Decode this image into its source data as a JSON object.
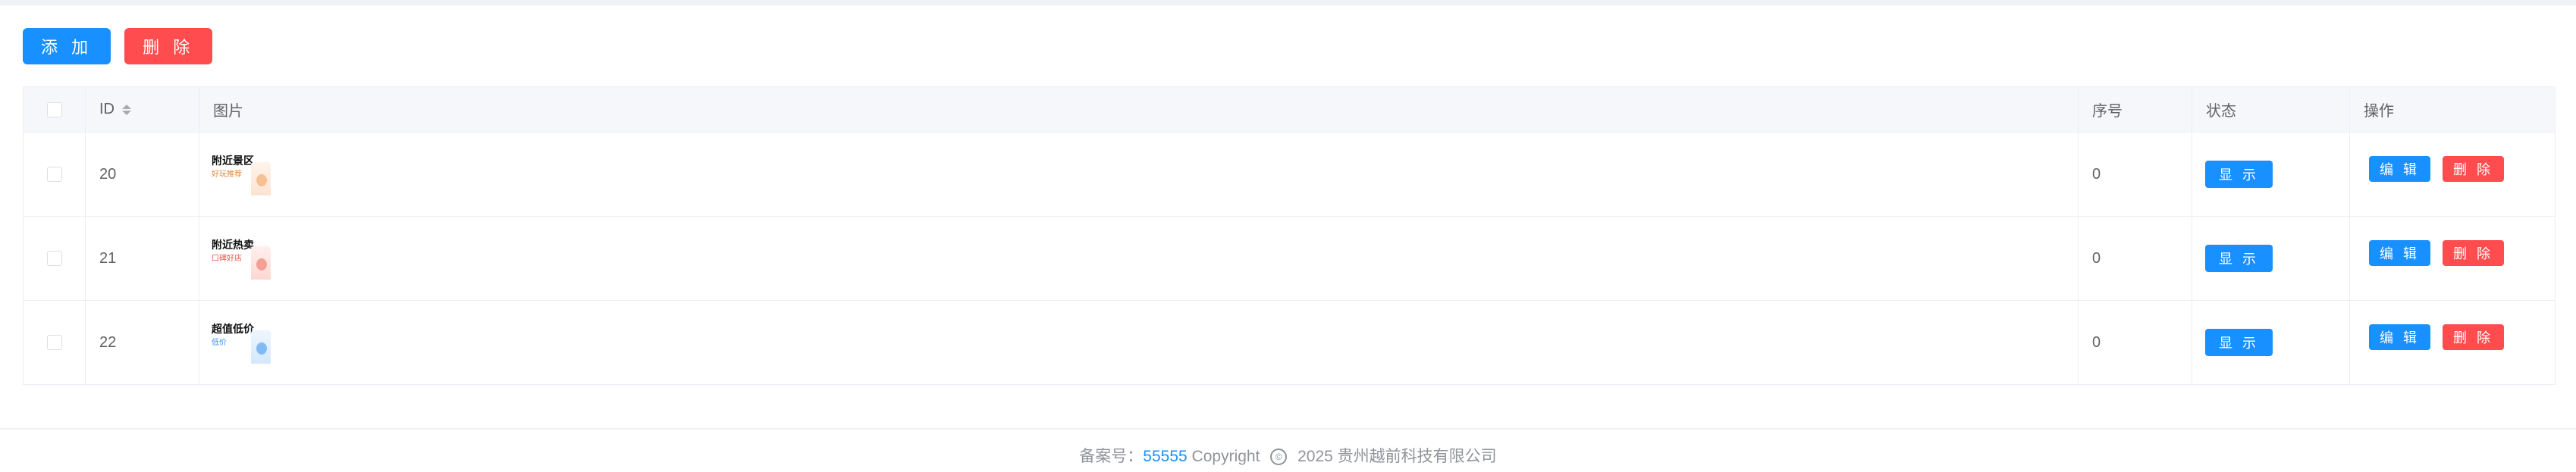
{
  "toolbar": {
    "add_label": "添 加",
    "delete_label": "删 除"
  },
  "table": {
    "headers": {
      "id": "ID",
      "image": "图片",
      "order": "序号",
      "status": "状态",
      "actions": "操作"
    },
    "rows": [
      {
        "id": "20",
        "image_title": "附近景区",
        "image_sub": "好玩推荐",
        "order": "0",
        "status": "显 示",
        "edit": "编 辑",
        "delete": "删 除"
      },
      {
        "id": "21",
        "image_title": "附近热卖",
        "image_sub": "口碑好店",
        "order": "0",
        "status": "显 示",
        "edit": "编 辑",
        "delete": "删 除"
      },
      {
        "id": "22",
        "image_title": "超值低价",
        "image_sub": "低价",
        "order": "0",
        "status": "显 示",
        "edit": "编 辑",
        "delete": "删 除"
      }
    ]
  },
  "footer": {
    "record_label": "备案号：",
    "record_number": "55555",
    "copyright": "Copyright",
    "copyright_icon": "©",
    "company": "2025 贵州越前科技有限公司"
  },
  "colors": {
    "primary": "#1890ff",
    "danger": "#ff4d4f",
    "header_bg": "#f5f7fa",
    "border": "#ebeef5"
  },
  "icons": {
    "sort": "sort-caret-icon",
    "copyright": "copyright-icon"
  }
}
